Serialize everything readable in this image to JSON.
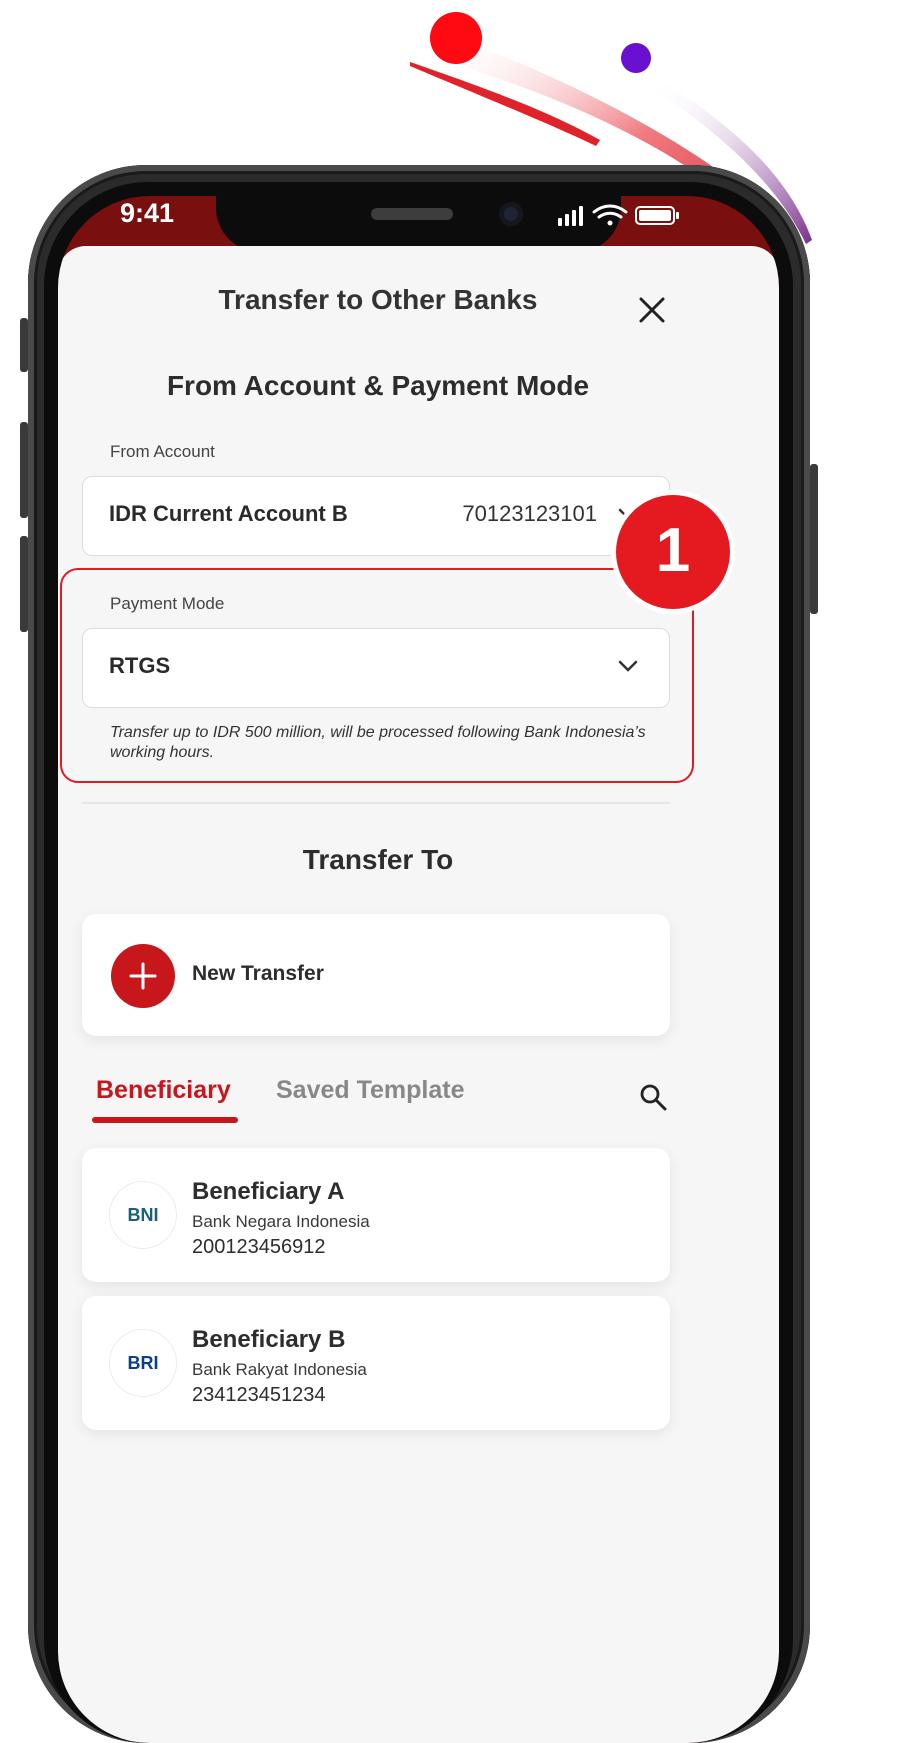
{
  "status_bar": {
    "time": "9:41"
  },
  "header": {
    "title": "Transfer to Other Banks"
  },
  "from_section": {
    "heading": "From Account &  Payment Mode",
    "from_account_label": "From Account",
    "from_account_name": "IDR Current Account B",
    "from_account_number": "70123123101",
    "payment_mode_label": "Payment Mode",
    "payment_mode_value": "RTGS",
    "payment_mode_note": "Transfer up to IDR 500 million, will be processed following Bank Indonesia’s working hours."
  },
  "transfer_to": {
    "heading": "Transfer To",
    "new_transfer_label": "New Transfer"
  },
  "tabs": [
    {
      "label": "Beneficiary",
      "active": true
    },
    {
      "label": "Saved Template",
      "active": false
    }
  ],
  "beneficiaries": [
    {
      "name": "Beneficiary A",
      "bank": "Bank Negara Indonesia",
      "account": "200123456912",
      "logo": "BNI",
      "logo_color": "#1a5f7a"
    },
    {
      "name": "Beneficiary B",
      "bank": "Bank Rakyat Indonesia",
      "account": "234123451234",
      "logo": "BRI",
      "logo_color": "#0b3d91"
    }
  ],
  "step_badge": "1",
  "colors": {
    "accent": "#c8161d",
    "highlight": "#e21b23",
    "header_bg": "#7a0f0f"
  }
}
